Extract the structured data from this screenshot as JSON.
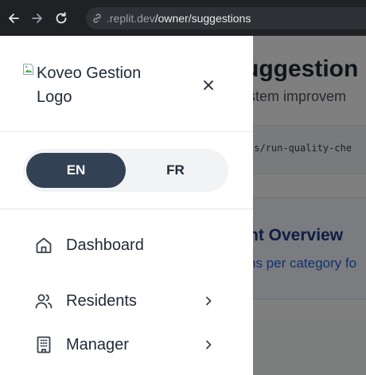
{
  "browser": {
    "url_prefix": ".replit.dev",
    "url_path": "/owner/suggestions"
  },
  "background_page": {
    "title": "uggestion",
    "subtitle": "stem improvem",
    "code_text": "ts/run-quality-che",
    "card_title": "nt Overview",
    "card_subtitle": "ns per category fo"
  },
  "drawer": {
    "logo_alt": "Koveo Gestion Logo",
    "language": {
      "options": [
        "EN",
        "FR"
      ],
      "selected": "EN"
    },
    "nav": [
      {
        "label": "Dashboard",
        "icon": "home-icon",
        "has_submenu": false
      },
      {
        "label": "Residents",
        "icon": "users-icon",
        "has_submenu": true
      },
      {
        "label": "Manager",
        "icon": "building-icon",
        "has_submenu": true
      }
    ]
  },
  "colors": {
    "active_toggle": "#334155",
    "browser_chrome": "#202124",
    "overlay": "rgba(0,0,0,0.5)"
  }
}
